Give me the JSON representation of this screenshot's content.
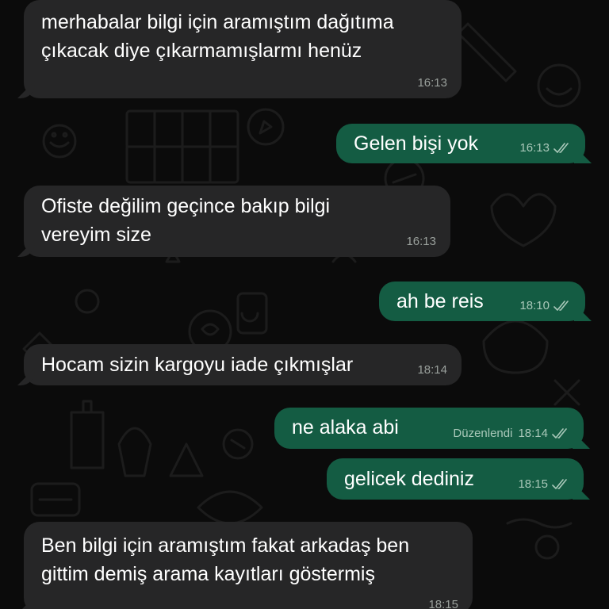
{
  "conversation": {
    "messages": [
      {
        "direction": "incoming",
        "text": "merhabalar bilgi için aramıştım dağıtıma\nçıkacak diye çıkarmamışlarmı henüz",
        "time": "16:13"
      },
      {
        "direction": "outgoing",
        "text": "Gelen bişi yok",
        "time": "16:13",
        "status": "read-double-check"
      },
      {
        "direction": "incoming",
        "text": "Ofiste değilim geçince bakıp bilgi\nvereyim size",
        "time": "16:13"
      },
      {
        "direction": "outgoing",
        "text": "ah be reis",
        "time": "18:10",
        "status": "read-double-check"
      },
      {
        "direction": "incoming",
        "text": "Hocam sizin kargoyu iade çıkmışlar",
        "time": "18:14"
      },
      {
        "direction": "outgoing",
        "text": "ne alaka abi",
        "time": "18:14",
        "edited_label": "Düzenlendi",
        "status": "read-double-check"
      },
      {
        "direction": "outgoing",
        "text": "gelicek dediniz",
        "time": "18:15",
        "status": "read-double-check"
      },
      {
        "direction": "incoming",
        "text": "Ben bilgi için aramıştım fakat arkadaş ben\ngittim demiş arama kayıtları göstermiş",
        "time": "18:15"
      }
    ]
  },
  "theme": {
    "background": "#0b0b0b",
    "incoming_bubble": "#262627",
    "outgoing_bubble": "#145c43",
    "text_color": "#ffffff"
  }
}
